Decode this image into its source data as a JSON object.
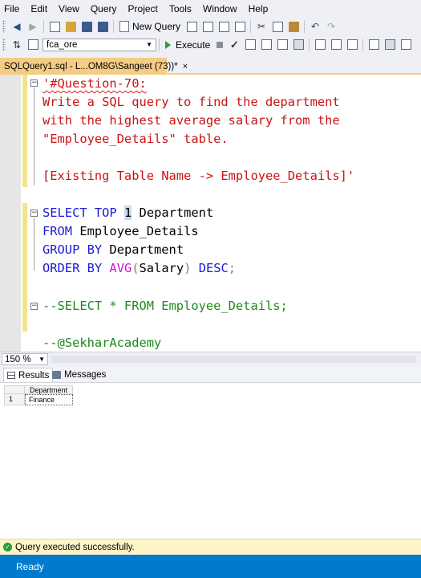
{
  "menu": [
    "File",
    "Edit",
    "View",
    "Query",
    "Project",
    "Tools",
    "Window",
    "Help"
  ],
  "toolbar": {
    "new_query_label": "New Query",
    "database": "fca_ore",
    "execute_label": "Execute"
  },
  "document_tab": {
    "title": "SQLQuery1.sql - L...OM8G\\Sangeet (73))*",
    "close_glyph": "×"
  },
  "editor": {
    "comment_line1": "'#Question-70:",
    "comment_line2": "Write a SQL query to find the department",
    "comment_line3": "with the highest average salary from the",
    "comment_line4": "\"Employee_Details\" table.",
    "comment_line6": "[Existing Table Name -> Employee_Details]'",
    "sql": {
      "select_kw": "SELECT",
      "top_kw": "TOP",
      "top_value": "1",
      "select_col": "Department",
      "from_kw": "FROM",
      "from_table": "Employee_Details",
      "group_kw": "GROUP BY",
      "group_col": "Department",
      "order_kw": "ORDER BY",
      "avg_fn": "AVG",
      "avg_open": "(",
      "avg_col": "Salary",
      "avg_close": ")",
      "desc_kw": "DESC",
      "terminator": ";"
    },
    "commented_select": "--SELECT * FROM Employee_Details;",
    "signature": "--@SekharAcademy"
  },
  "zoom": "150 %",
  "result_tabs": {
    "results": "Results",
    "messages": "Messages"
  },
  "results_grid": {
    "column": "Department",
    "rows": [
      {
        "num": "1",
        "department": "Finance"
      }
    ]
  },
  "query_status": "Query executed successfully.",
  "status": "Ready",
  "colors": {
    "statusbar": "#007acc",
    "tab_active": "#f5cc84",
    "keyword": "#1a1ad8",
    "string": "#c81414",
    "comment": "#1d8a1d",
    "function": "#d014d0"
  }
}
